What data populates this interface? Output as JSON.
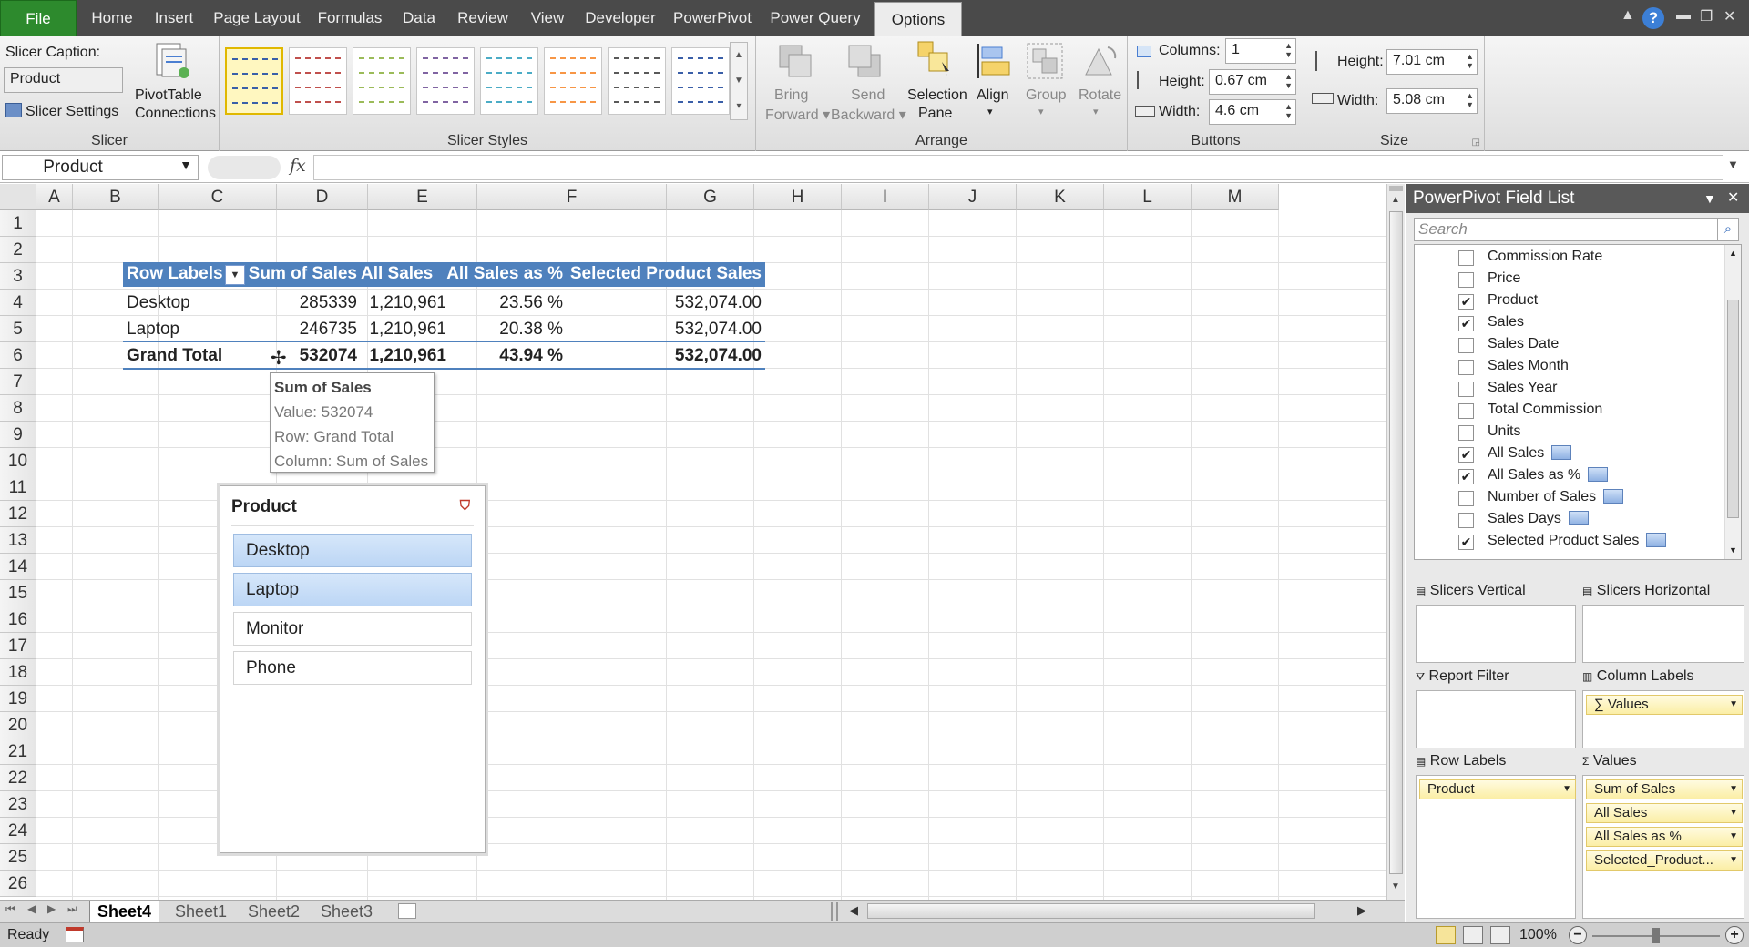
{
  "ribbon_tabs": [
    "File",
    "Home",
    "Insert",
    "Page Layout",
    "Formulas",
    "Data",
    "Review",
    "View",
    "Developer",
    "PowerPivot",
    "Power Query",
    "Options"
  ],
  "active_tab": "Options",
  "ribbon": {
    "slicer_caption_label": "Slicer Caption:",
    "slicer_caption_value": "Product",
    "slicer_settings": "Slicer Settings",
    "pivot_connections_1": "PivotTable",
    "pivot_connections_2": "Connections",
    "slicer_group": "Slicer",
    "slicer_styles_group": "Slicer Styles",
    "style_colors": [
      "#3a5fa8",
      "#c0504d",
      "#9bbb59",
      "#8064a2",
      "#4bacc6",
      "#f79646",
      "#595959",
      "#3a5fa8"
    ],
    "bring_forward_1": "Bring",
    "bring_forward_2": "Forward",
    "send_backward_1": "Send",
    "send_backward_2": "Backward",
    "selection_pane_1": "Selection",
    "selection_pane_2": "Pane",
    "align": "Align",
    "group": "Group",
    "rotate": "Rotate",
    "arrange_group": "Arrange",
    "columns_label": "Columns:",
    "columns_value": "1",
    "btn_height_label": "Height:",
    "btn_height_value": "0.67 cm",
    "btn_width_label": "Width:",
    "btn_width_value": "4.6 cm",
    "buttons_group": "Buttons",
    "size_height_label": "Height:",
    "size_height_value": "7.01 cm",
    "size_width_label": "Width:",
    "size_width_value": "5.08 cm",
    "size_group": "Size"
  },
  "namebox": "Product",
  "columns": [
    "A",
    "B",
    "C",
    "D",
    "E",
    "F",
    "G",
    "H",
    "I",
    "J",
    "K",
    "L",
    "M"
  ],
  "rows": [
    "1",
    "2",
    "3",
    "4",
    "5",
    "6",
    "7",
    "8",
    "9",
    "10",
    "11",
    "12",
    "13",
    "14",
    "15",
    "16",
    "17",
    "18",
    "19",
    "20",
    "21",
    "22",
    "23",
    "24",
    "25",
    "26"
  ],
  "pivot": {
    "header": [
      "Row Labels",
      "Sum of Sales",
      "All Sales",
      "All Sales as %",
      "Selected Product Sales"
    ],
    "rows": [
      [
        "Desktop",
        "285339",
        "1,210,961",
        "23.56 %",
        "532,074.00"
      ],
      [
        "Laptop",
        "246735",
        "1,210,961",
        "20.38 %",
        "532,074.00"
      ]
    ],
    "total": [
      "Grand Total",
      "532074",
      "1,210,961",
      "43.94 %",
      "532,074.00"
    ],
    "header_color": "#4f81bd"
  },
  "tooltip": {
    "title": "Sum of Sales",
    "value": "Value: 532074",
    "row": "Row: Grand Total",
    "column": "Column: Sum of Sales"
  },
  "slicer": {
    "title": "Product",
    "items": [
      {
        "label": "Desktop",
        "selected": true
      },
      {
        "label": "Laptop",
        "selected": true
      },
      {
        "label": "Monitor",
        "selected": false
      },
      {
        "label": "Phone",
        "selected": false
      }
    ]
  },
  "sheets": [
    "Sheet4",
    "Sheet1",
    "Sheet2",
    "Sheet3"
  ],
  "active_sheet": "Sheet4",
  "status": {
    "ready": "Ready",
    "zoom": "100%"
  },
  "powerpivot": {
    "title": "PowerPivot Field List",
    "search_placeholder": "Search",
    "fields": [
      {
        "name": "Commission Rate",
        "checked": false,
        "calc": false
      },
      {
        "name": "Price",
        "checked": false,
        "calc": false
      },
      {
        "name": "Product",
        "checked": true,
        "calc": false
      },
      {
        "name": "Sales",
        "checked": true,
        "calc": false
      },
      {
        "name": "Sales Date",
        "checked": false,
        "calc": false
      },
      {
        "name": "Sales Month",
        "checked": false,
        "calc": false
      },
      {
        "name": "Sales Year",
        "checked": false,
        "calc": false
      },
      {
        "name": "Total Commission",
        "checked": false,
        "calc": false
      },
      {
        "name": "Units",
        "checked": false,
        "calc": false
      },
      {
        "name": "All Sales",
        "checked": true,
        "calc": true
      },
      {
        "name": "All Sales as %",
        "checked": true,
        "calc": true
      },
      {
        "name": "Number of Sales",
        "checked": false,
        "calc": true
      },
      {
        "name": "Sales Days",
        "checked": false,
        "calc": true
      },
      {
        "name": "Selected Product Sales",
        "checked": true,
        "calc": true
      }
    ],
    "zones": {
      "slicers_vertical": "Slicers Vertical",
      "slicers_horizontal": "Slicers Horizontal",
      "report_filter": "Report Filter",
      "column_labels": "Column Labels",
      "row_labels": "Row Labels",
      "values": "Values",
      "column_items": [
        "∑ Values"
      ],
      "row_items": [
        "Product"
      ],
      "value_items": [
        "Sum of Sales",
        "All Sales",
        "All Sales as %",
        "Selected_Product..."
      ]
    }
  }
}
